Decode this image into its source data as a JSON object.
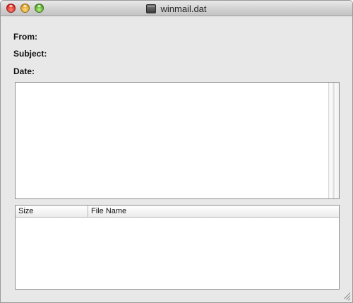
{
  "window": {
    "title": "winmail.dat"
  },
  "headers": {
    "from_label": "From:",
    "subject_label": "Subject:",
    "date_label": "Date:"
  },
  "attachments": {
    "columns": [
      "Size",
      "File Name"
    ],
    "rows": []
  },
  "colors": {
    "window_bg": "#e8e8e8",
    "close_button": "#d9241b",
    "minimize_button": "#d99a16",
    "zoom_button": "#4ea21c"
  }
}
